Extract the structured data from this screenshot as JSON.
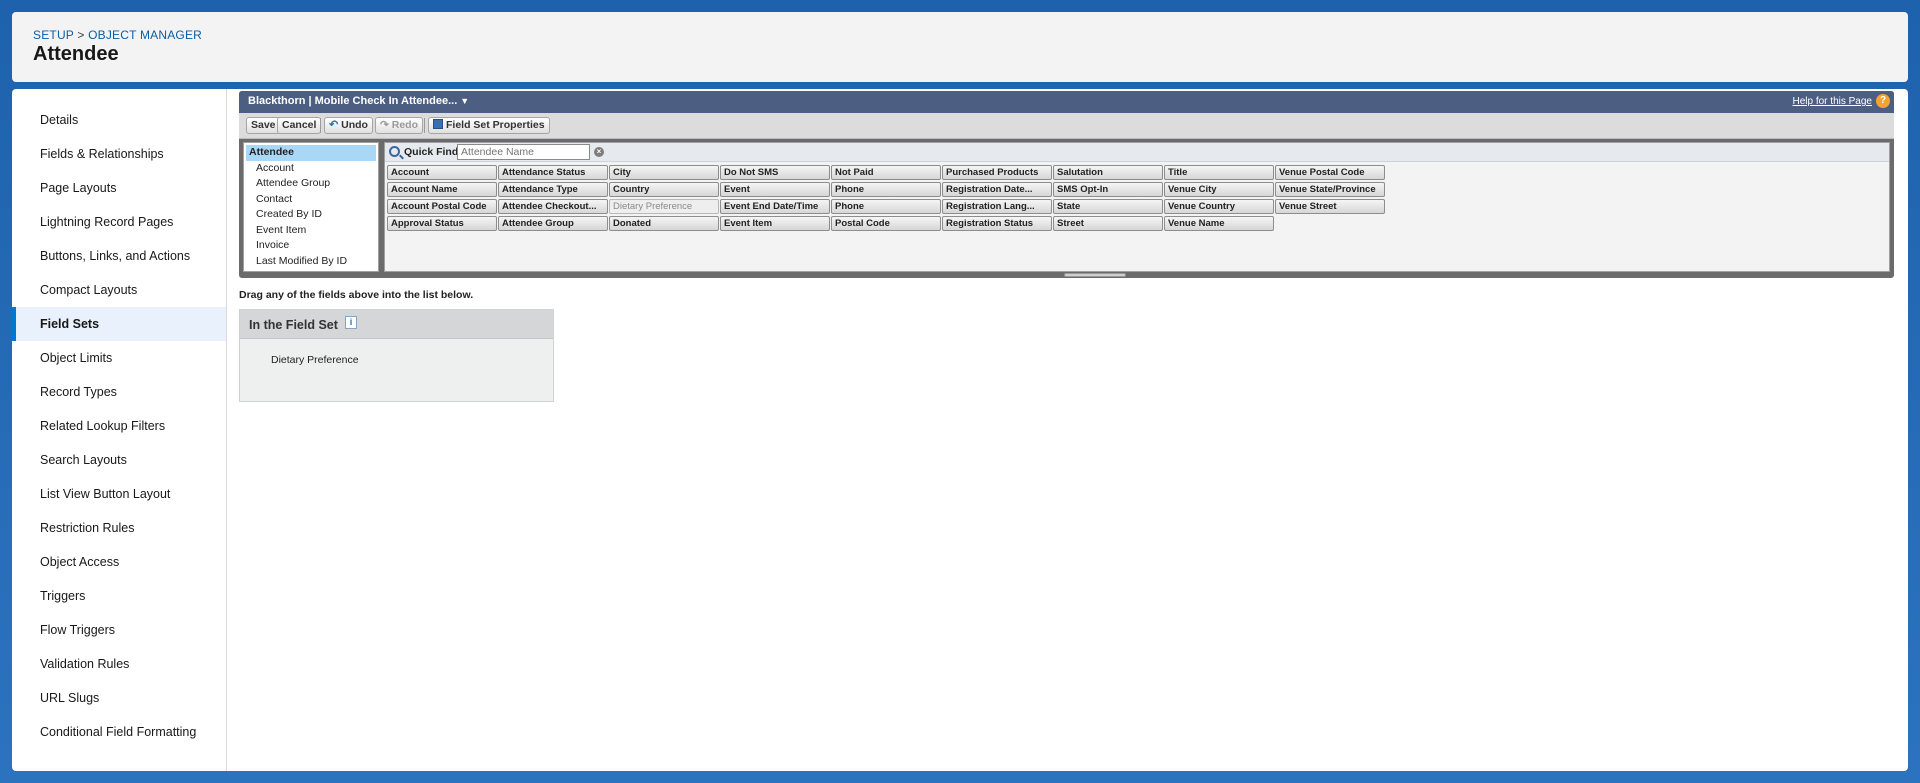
{
  "header": {
    "breadcrumb_setup": "SETUP",
    "breadcrumb_sep": ">",
    "breadcrumb_object_manager": "OBJECT MANAGER",
    "title": "Attendee"
  },
  "sidebar": {
    "items": [
      {
        "label": "Details"
      },
      {
        "label": "Fields & Relationships"
      },
      {
        "label": "Page Layouts"
      },
      {
        "label": "Lightning Record Pages"
      },
      {
        "label": "Buttons, Links, and Actions"
      },
      {
        "label": "Compact Layouts"
      },
      {
        "label": "Field Sets",
        "active": true
      },
      {
        "label": "Object Limits"
      },
      {
        "label": "Record Types"
      },
      {
        "label": "Related Lookup Filters"
      },
      {
        "label": "Search Layouts"
      },
      {
        "label": "List View Button Layout"
      },
      {
        "label": "Restriction Rules"
      },
      {
        "label": "Object Access"
      },
      {
        "label": "Triggers"
      },
      {
        "label": "Flow Triggers"
      },
      {
        "label": "Validation Rules"
      },
      {
        "label": "URL Slugs"
      },
      {
        "label": "Conditional Field Formatting"
      }
    ]
  },
  "palette": {
    "title": "Blackthorn | Mobile Check In Attendee...",
    "help_link": "Help for this Page",
    "help_icon": "?"
  },
  "toolbar": {
    "save": "Save",
    "cancel": "Cancel",
    "undo": "Undo",
    "redo": "Redo",
    "field_set_properties": "Field Set Properties"
  },
  "objects": [
    {
      "label": "Attendee",
      "selected": true
    },
    {
      "label": "Account"
    },
    {
      "label": "Attendee Group"
    },
    {
      "label": "Contact"
    },
    {
      "label": "Created By ID"
    },
    {
      "label": "Event Item"
    },
    {
      "label": "Invoice"
    },
    {
      "label": "Last Modified By ID"
    }
  ],
  "quick_find": {
    "label": "Quick Find",
    "placeholder": "Attendee Name",
    "clear": "×"
  },
  "fields": [
    [
      "Account",
      "Account Name",
      "Account Postal Code",
      "Approval Status"
    ],
    [
      "Attendance Status",
      "Attendance Type",
      "Attendee Checkout...",
      "Attendee Group"
    ],
    [
      "City",
      "Country",
      "Dietary Preference",
      "Donated"
    ],
    [
      "Do Not SMS",
      "Event",
      "Event End Date/Time",
      "Event Item"
    ],
    [
      "Not Paid",
      "Phone",
      "Phone",
      "Postal Code"
    ],
    [
      "Purchased Products",
      "Registration Date...",
      "Registration Lang...",
      "Registration Status"
    ],
    [
      "Salutation",
      "SMS Opt-In",
      "State",
      "Street"
    ],
    [
      "Title",
      "Venue City",
      "Venue Country",
      "Venue Name"
    ],
    [
      "Venue Postal Code",
      "Venue State/Province",
      "Venue Street"
    ]
  ],
  "used_fields": [
    "Dietary Preference"
  ],
  "instructions": "Drag any of the fields above into the list below.",
  "field_set": {
    "title": "In the Field Set",
    "info_icon": "i",
    "items": [
      "Dietary Preference"
    ]
  },
  "colors": {
    "background": "#1e62ad",
    "palette_header": "#4c5e82",
    "active_nav": "#0176d3"
  }
}
